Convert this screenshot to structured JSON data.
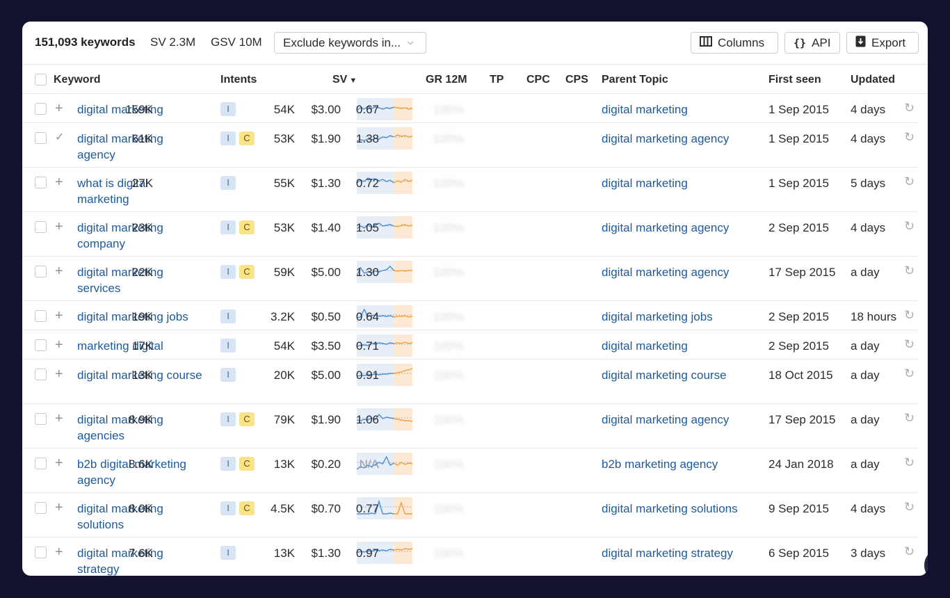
{
  "toolbar": {
    "count": "151,093 keywords",
    "sv": "SV 2.3M",
    "gsv": "GSV 10M",
    "exclude_label": "Exclude keywords in...",
    "columns_label": "Columns",
    "api_label": "API",
    "export_label": "Export"
  },
  "headers": {
    "keyword": "Keyword",
    "intents": "Intents",
    "sv": "SV",
    "gr": "GR 12M",
    "tp": "TP",
    "cpc": "CPC",
    "cps": "CPS",
    "parent": "Parent Topic",
    "first_seen": "First seen",
    "updated": "Updated"
  },
  "rows": [
    {
      "keyword": "digital marketing",
      "intents": [
        "I"
      ],
      "sv": "159K",
      "gr": "100%",
      "tp": "54K",
      "cpc": "$3.00",
      "cps": "0.67",
      "parent": "digital marketing",
      "first_seen": "1 Sep 2015",
      "updated": "4 days",
      "action": "plus"
    },
    {
      "keyword": "digital marketing agency",
      "intents": [
        "I",
        "C"
      ],
      "sv": "61K",
      "gr": "100%",
      "tp": "53K",
      "cpc": "$1.90",
      "cps": "1.38",
      "parent": "digital marketing agency",
      "first_seen": "1 Sep 2015",
      "updated": "4 days",
      "action": "check"
    },
    {
      "keyword": "what is digital marketing",
      "intents": [
        "I"
      ],
      "sv": "27K",
      "gr": "100%",
      "tp": "55K",
      "cpc": "$1.30",
      "cps": "0.72",
      "parent": "digital marketing",
      "first_seen": "1 Sep 2015",
      "updated": "5 days",
      "action": "plus"
    },
    {
      "keyword": "digital marketing company",
      "intents": [
        "I",
        "C"
      ],
      "sv": "23K",
      "gr": "100%",
      "tp": "53K",
      "cpc": "$1.40",
      "cps": "1.05",
      "parent": "digital marketing agency",
      "first_seen": "2 Sep 2015",
      "updated": "4 days",
      "action": "plus"
    },
    {
      "keyword": "digital marketing services",
      "intents": [
        "I",
        "C"
      ],
      "sv": "22K",
      "gr": "100%",
      "tp": "59K",
      "cpc": "$5.00",
      "cps": "1.30",
      "parent": "digital marketing agency",
      "first_seen": "17 Sep 2015",
      "updated": "a day",
      "action": "plus"
    },
    {
      "keyword": "digital marketing jobs",
      "intents": [
        "I"
      ],
      "sv": "19K",
      "gr": "100%",
      "tp": "3.2K",
      "cpc": "$0.50",
      "cps": "0.64",
      "parent": "digital marketing jobs",
      "first_seen": "2 Sep 2015",
      "updated": "18 hours",
      "action": "plus"
    },
    {
      "keyword": "marketing digital",
      "intents": [
        "I"
      ],
      "sv": "17K",
      "gr": "100%",
      "tp": "54K",
      "cpc": "$3.50",
      "cps": "0.71",
      "parent": "digital marketing",
      "first_seen": "2 Sep 2015",
      "updated": "a day",
      "action": "plus"
    },
    {
      "keyword": "digital marketing course",
      "intents": [
        "I"
      ],
      "sv": "13K",
      "gr": "100%",
      "tp": "20K",
      "cpc": "$5.00",
      "cps": "0.91",
      "parent": "digital marketing course",
      "first_seen": "18 Oct 2015",
      "updated": "a day",
      "action": "plus"
    },
    {
      "keyword": "digital marketing agencies",
      "intents": [
        "I",
        "C"
      ],
      "sv": "8.9K",
      "gr": "100%",
      "tp": "79K",
      "cpc": "$1.90",
      "cps": "1.06",
      "parent": "digital marketing agency",
      "first_seen": "17 Sep 2015",
      "updated": "a day",
      "action": "plus"
    },
    {
      "keyword": "b2b digital marketing agency",
      "intents": [
        "I",
        "C"
      ],
      "sv": "8.6K",
      "gr": "100%",
      "tp": "13K",
      "cpc": "$0.20",
      "cps": "N/A",
      "parent": "b2b marketing agency",
      "first_seen": "24 Jan 2018",
      "updated": "a day",
      "action": "plus"
    },
    {
      "keyword": "digital marketing solutions",
      "intents": [
        "I",
        "C"
      ],
      "sv": "8.0K",
      "gr": "100%",
      "tp": "4.5K",
      "cpc": "$0.70",
      "cps": "0.77",
      "parent": "digital marketing solutions",
      "first_seen": "9 Sep 2015",
      "updated": "4 days",
      "action": "plus"
    },
    {
      "keyword": "digital marketing strategy",
      "intents": [
        "I"
      ],
      "sv": "7.6K",
      "gr": "100%",
      "tp": "13K",
      "cpc": "$1.30",
      "cps": "0.97",
      "parent": "digital marketing strategy",
      "first_seen": "6 Sep 2015",
      "updated": "3 days",
      "action": "plus"
    }
  ],
  "help_label": "?",
  "colors": {
    "link": "#1d5a9a",
    "spark_blue": "#4a8fd4",
    "spark_orange": "#f0a040",
    "background": "#12122e"
  },
  "icons": {
    "columns": "columns-icon",
    "api": "braces-icon",
    "export": "download-icon",
    "refresh": "refresh-icon",
    "add": "plus-icon",
    "added": "check-icon"
  }
}
